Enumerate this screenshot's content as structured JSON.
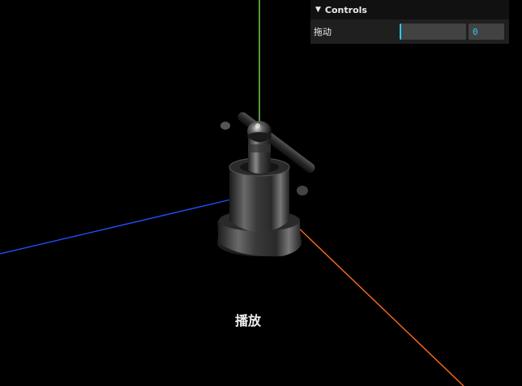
{
  "gui": {
    "title": "Controls",
    "row_label": "拖动",
    "value": "0",
    "level": 0
  },
  "play_label": "播放",
  "axis_colors": {
    "x": "#ff6a1a",
    "y": "#8cff6a",
    "z": "#2050ff"
  }
}
